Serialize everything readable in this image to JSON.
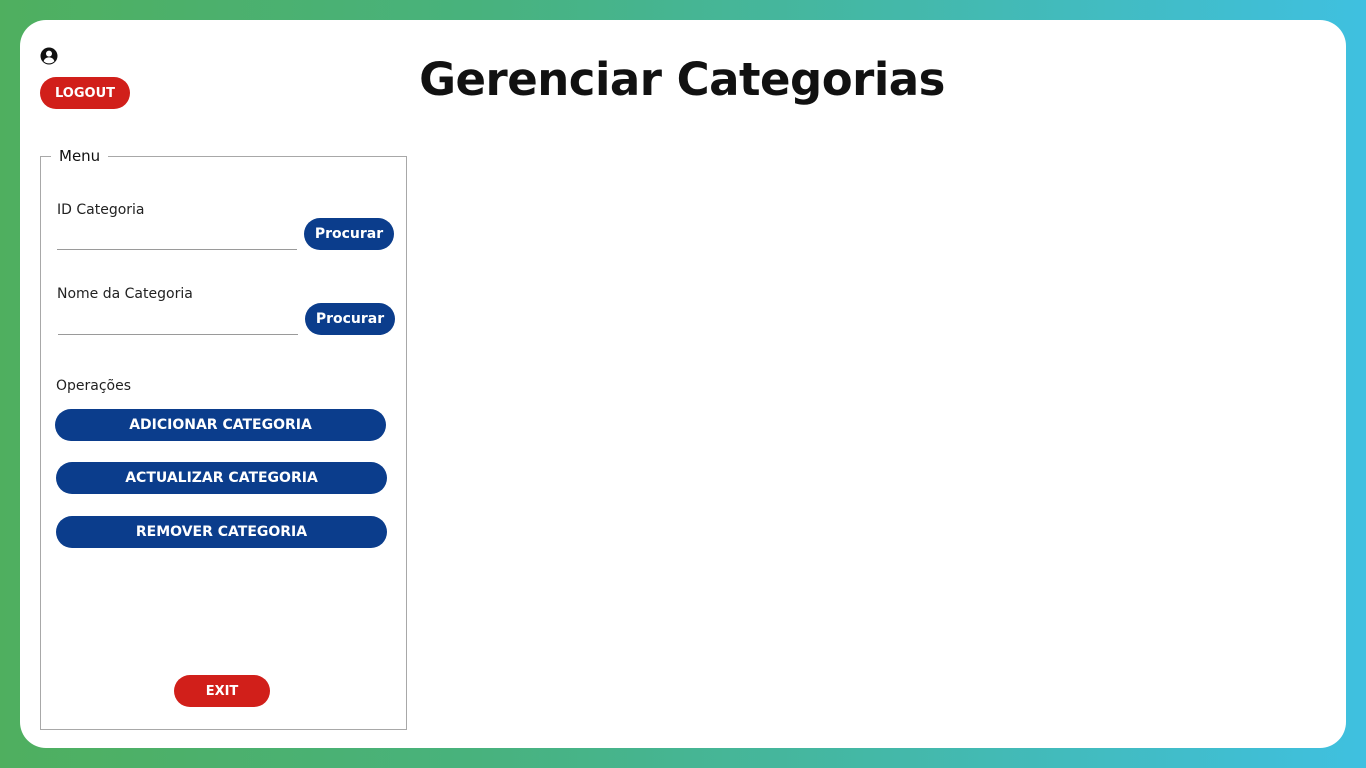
{
  "header": {
    "title": "Gerenciar Categorias",
    "user_icon": "user-circle-icon",
    "logout_label": "LOGOUT"
  },
  "menu": {
    "legend": "Menu",
    "id_field": {
      "label": "ID Categoria",
      "value": "",
      "search_label": "Procurar"
    },
    "name_field": {
      "label": "Nome da Categoria",
      "value": "",
      "search_label": "Procurar"
    },
    "operations": {
      "label": "Operações",
      "add_label": "ADICIONAR CATEGORIA",
      "update_label": "ACTUALIZAR CATEGORIA",
      "remove_label": "REMOVER CATEGORIA"
    },
    "exit_label": "EXIT"
  },
  "colors": {
    "primary_blue": "#0b3d8c",
    "danger_red": "#d11f1a",
    "background_gradient_start": "#4faf5f",
    "background_gradient_end": "#3fc0e0"
  }
}
